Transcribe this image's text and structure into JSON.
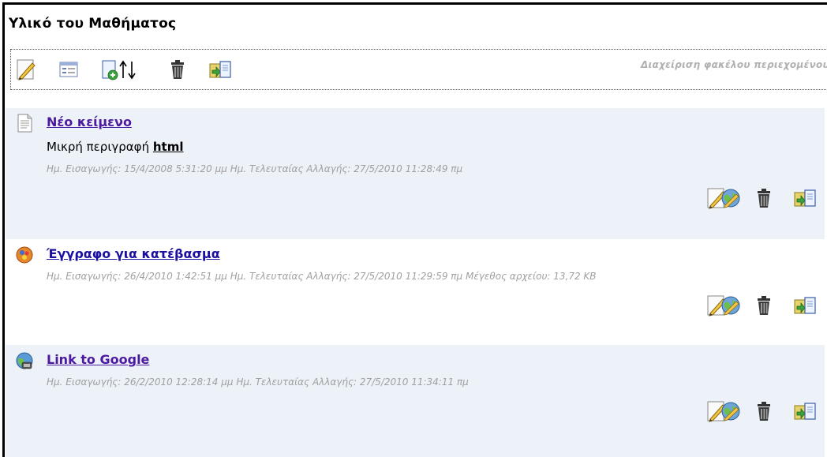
{
  "header": {
    "title": "Υλικό του Μαθήματος",
    "folder_admin_label": "Διαχείριση φακέλου περιεχομένου"
  },
  "toolbar_icons": [
    "edit-icon",
    "properties-icon",
    "add-sort-icon",
    "delete-icon",
    "copy-move-icon"
  ],
  "items": [
    {
      "title": "Νέο κείμενο",
      "icon": "text-document-icon",
      "description_prefix": "Μικρή περιγραφή",
      "description_html": "html",
      "meta": "Ημ. Εισαγωγής: 15/4/2008 5:31:20 μμ Ημ. Τελευταίας Αλλαγής: 27/5/2010 11:28:49 πμ"
    },
    {
      "title": "Έγγραφο για κατέβασμα",
      "icon": "download-file-icon",
      "meta": "Ημ. Εισαγωγής: 26/4/2010 1:42:51 μμ Ημ. Τελευταίας Αλλαγής: 27/5/2010 11:29:59 πμ Μέγεθος αρχείου: 13,72 KB"
    },
    {
      "title": "Link to Google",
      "icon": "web-link-icon",
      "meta": "Ημ. Εισαγωγής: 26/2/2010 12:28:14 μμ Ημ. Τελευταίας Αλλαγής: 27/5/2010 11:34:11 πμ"
    }
  ],
  "item_action_icons": [
    "edit-item-icon",
    "delete-item-icon",
    "copy-move-item-icon"
  ]
}
